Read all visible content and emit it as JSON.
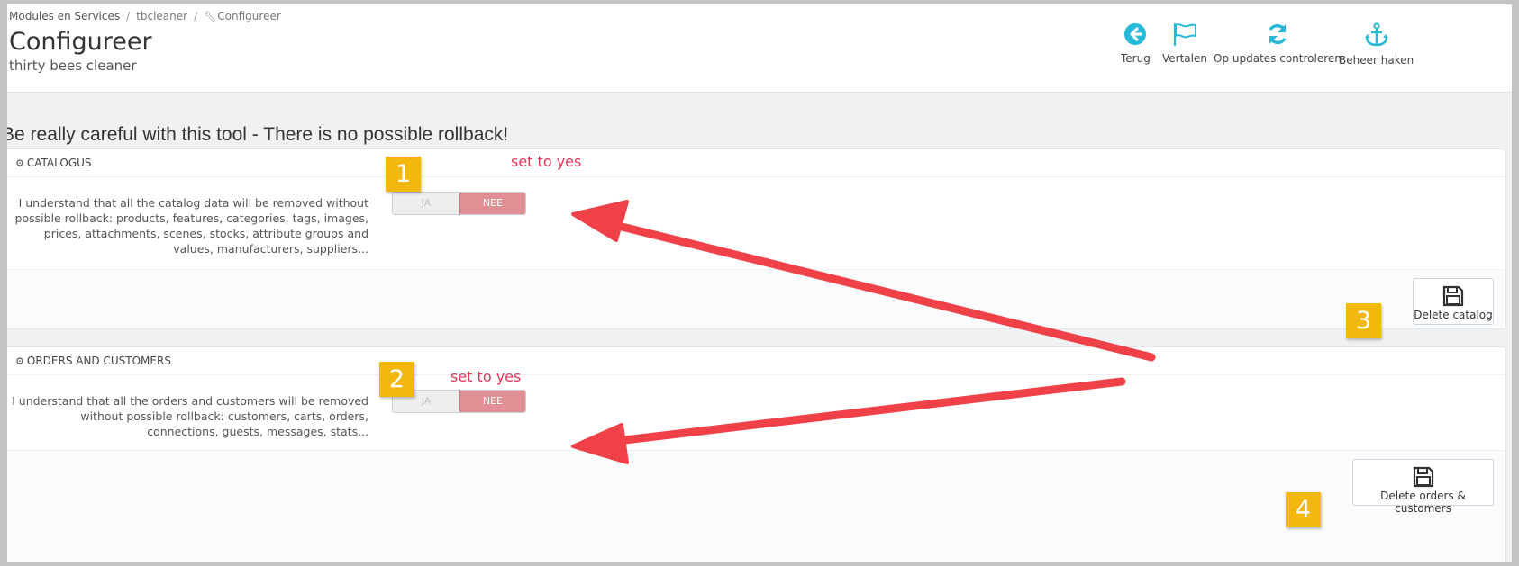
{
  "breadcrumb": {
    "items": [
      "Modules en Services",
      "tbcleaner",
      "Configureer"
    ]
  },
  "header": {
    "title": "Configureer",
    "subtitle": "thirty bees cleaner"
  },
  "toolbar": {
    "back_label": "Terug",
    "translate_label": "Vertalen",
    "updates_label": "Op updates controleren",
    "hooks_label": "Beheer haken",
    "icon_color": "#25b9d7"
  },
  "warning": "Be really careful with this tool - There is no possible rollback!",
  "catalog_panel": {
    "heading": "CATALOGUS",
    "description": "I understand that all the catalog data will be removed without possible rollback: products, features, categories, tags, images, prices, attachments, scenes, stocks, attribute groups and values, manufacturers, suppliers...",
    "switch_yes": "JA",
    "switch_no": "NEE",
    "selected": "NEE",
    "submit_label": "Delete catalog"
  },
  "orders_panel": {
    "heading": "ORDERS AND CUSTOMERS",
    "description": "I understand that all the orders and customers will be removed without possible rollback: customers, carts, orders, connections, guests, messages, stats...",
    "switch_yes": "JA",
    "switch_no": "NEE",
    "selected": "NEE",
    "submit_label": "Delete orders & customers"
  },
  "annotations": {
    "badges": [
      "1",
      "2",
      "3",
      "4"
    ],
    "note_1": "set to yes",
    "note_2": "set to yes",
    "badge_color": "#f3b80f",
    "note_color": "#e23757",
    "arrow_color": "#f04048"
  }
}
